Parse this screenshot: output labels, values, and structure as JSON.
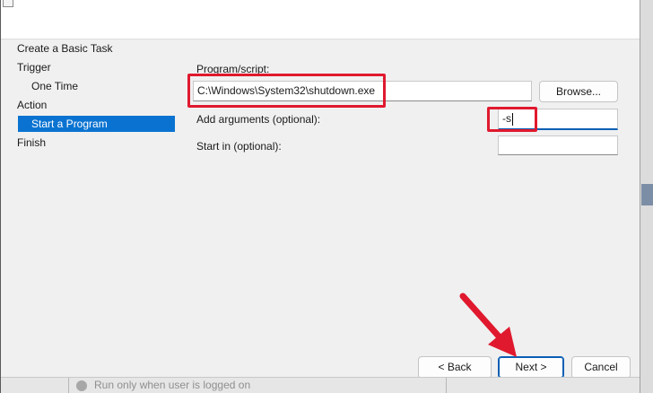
{
  "nav": {
    "items": [
      {
        "label": "Create a Basic Task"
      },
      {
        "label": "Trigger"
      },
      {
        "label": "One Time"
      },
      {
        "label": "Action"
      },
      {
        "label": "Start a Program"
      },
      {
        "label": "Finish"
      }
    ]
  },
  "form": {
    "program_label": "Program/script:",
    "program_value": "C:\\Windows\\System32\\shutdown.exe",
    "browse_label": "Browse...",
    "arguments_label": "Add arguments (optional):",
    "arguments_value": "-s",
    "start_in_label": "Start in (optional):",
    "start_in_value": ""
  },
  "buttons": {
    "back_label": "< Back",
    "next_label": "Next >",
    "cancel_label": "Cancel"
  },
  "background": {
    "option_text": "Run only when user is logged on"
  },
  "colors": {
    "selection": "#0a73d1",
    "highlight": "#e0192e",
    "focus_underline": "#0a5fb4"
  }
}
